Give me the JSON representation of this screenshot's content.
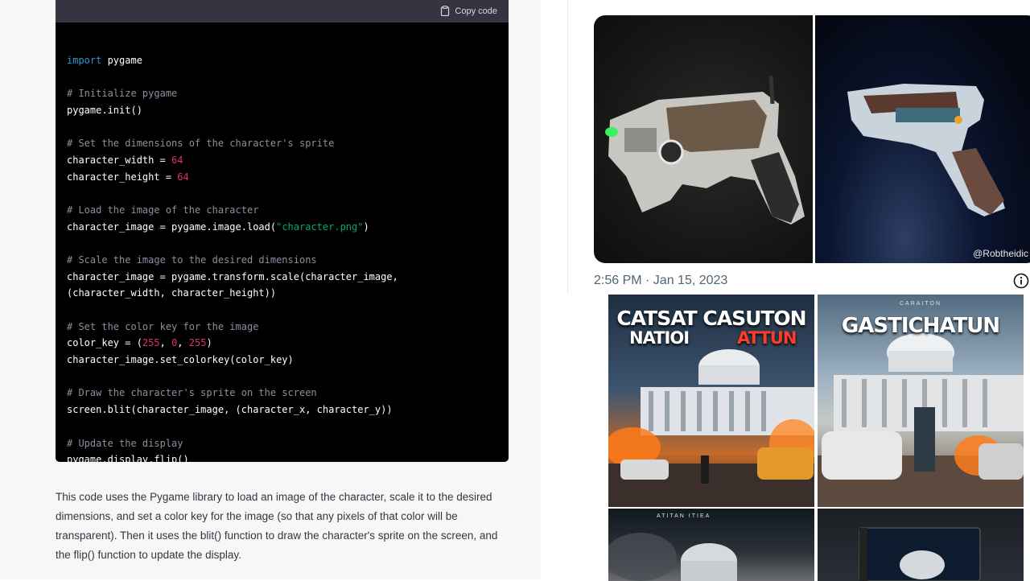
{
  "chat": {
    "copy_label": "Copy code",
    "explanation": "This code uses the Pygame library to load an image of the character, scale it to the desired dimensions, and set a color key for the image (so that any pixels of that color will be transparent). Then it uses the blit() function to draw the character's sprite on the screen, and the flip() function to update the display."
  },
  "code": {
    "l01_kw": "import",
    "l01_rest": " pygame",
    "l03": "# Initialize pygame",
    "l04": "pygame.init()",
    "l06": "# Set the dimensions of the character's sprite",
    "l07_a": "character_width = ",
    "l07_n": "64",
    "l08_a": "character_height = ",
    "l08_n": "64",
    "l10": "# Load the image of the character",
    "l11_a": "character_image = pygame.image.load(",
    "l11_s": "\"character.png\"",
    "l11_b": ")",
    "l13": "# Scale the image to the desired dimensions",
    "l14": "character_image = pygame.transform.scale(character_image,",
    "l15": "(character_width, character_height))",
    "l17": "# Set the color key for the image",
    "l18_a": "color_key = (",
    "l18_n1": "255",
    "l18_c1": ", ",
    "l18_n2": "0",
    "l18_c2": ", ",
    "l18_n3": "255",
    "l18_b": ")",
    "l19": "character_image.set_colorkey(color_key)",
    "l21": "# Draw the character's sprite on the screen",
    "l22": "screen.blit(character_image, (character_x, character_y))",
    "l24": "# Update the display",
    "l25": "pygame.display.flip()"
  },
  "tweet": {
    "handle": "@Robtheidic",
    "timestamp": "2:56 PM · Jan 15, 2023"
  },
  "posters": {
    "p1_line1": "CATSAT CASUTON",
    "p1_line2a": "NATIOI",
    "p1_line2b": "ATTUN",
    "p2_small": "CARAITON",
    "p2_title": "GASTICHATUN",
    "p3_small": "ATITAN ITIEA"
  },
  "colors": {
    "code_bg": "#000000",
    "code_header": "#343541",
    "keyword": "#2e95d3",
    "comment": "#8e8ea0",
    "number": "#df3079",
    "string": "#00a67d"
  }
}
